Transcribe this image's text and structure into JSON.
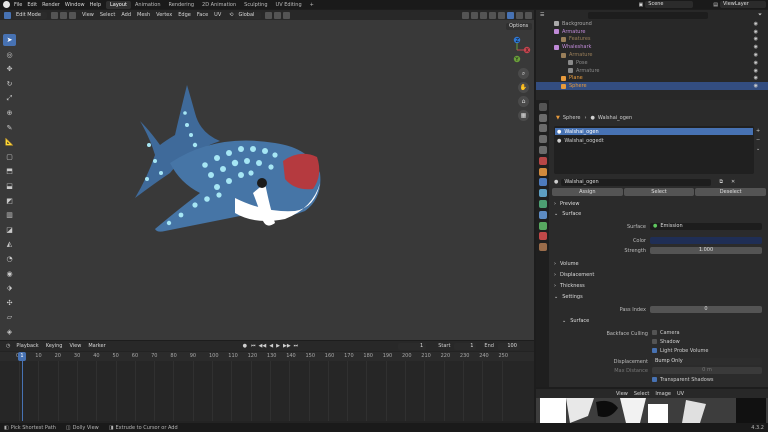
{
  "menu": [
    "File",
    "Edit",
    "Render",
    "Window",
    "Help"
  ],
  "workspaces": [
    "Layout",
    "Animation",
    "Rendering",
    "2D Animation",
    "Sculpting",
    "UV Editing"
  ],
  "active_workspace": "Layout",
  "add_tab": "+",
  "scene": "Scene",
  "view_layer": "ViewLayer",
  "viewport": {
    "mode": "Edit Mode",
    "menus": [
      "View",
      "Select",
      "Add",
      "Mesh",
      "Vertex",
      "Edge",
      "Face",
      "UV"
    ],
    "orientation": "Global",
    "options": "Options"
  },
  "gizmo": {
    "y": "Y",
    "x": "X",
    "z": "Z"
  },
  "timeline": {
    "menus": [
      "Playback",
      "Keying",
      "View",
      "Marker"
    ],
    "current_frame": "1",
    "start_label": "Start",
    "start": "1",
    "end_label": "End",
    "end": "100",
    "ruler": [
      "0",
      "10",
      "20",
      "30",
      "40",
      "50",
      "60",
      "70",
      "80",
      "90",
      "100",
      "110",
      "120",
      "130",
      "140",
      "150",
      "160",
      "170",
      "180",
      "190",
      "200",
      "210",
      "220",
      "230",
      "240",
      "250"
    ]
  },
  "outliner": {
    "search_placeholder": "",
    "rows": [
      {
        "label": "Background",
        "indent": 2,
        "color": "#a9a9a9"
      },
      {
        "label": "Armature",
        "indent": 2,
        "color": "#c08ad8"
      },
      {
        "label": "Features",
        "indent": 3,
        "color": "#9a7f5a"
      },
      {
        "label": "Whaleshark",
        "indent": 2,
        "color": "#c08ad8"
      },
      {
        "label": "Armature",
        "indent": 3,
        "color": "#9a7f5a"
      },
      {
        "label": "Pose",
        "indent": 4,
        "color": "#8a8a8a"
      },
      {
        "label": "Armature",
        "indent": 4,
        "color": "#8a8a8a"
      },
      {
        "label": "Plane",
        "indent": 3,
        "color": "#e79a3c"
      },
      {
        "label": "Sphere",
        "indent": 3,
        "color": "#e79a3c",
        "selected": true
      }
    ]
  },
  "properties": {
    "breadcrumb": [
      "Sphere",
      "Walshai_ogen"
    ],
    "materials": [
      "Walshai_ogen",
      "Walshai_oogedt"
    ],
    "active_material": "Walshai_ogen",
    "slot_buttons": [
      "Assign",
      "Select",
      "Deselect"
    ],
    "sections": {
      "preview": "Preview",
      "surface": "Surface",
      "volume": "Volume",
      "displacement": "Displacement",
      "thickness": "Thickness",
      "settings": "Settings",
      "surface_sub": "Surface"
    },
    "surface_label": "Surface",
    "surface_value": "Emission",
    "color_label": "Color",
    "color_value": "#1f2e55",
    "strength_label": "Strength",
    "strength_value": "1.000",
    "pass_index_label": "Pass Index",
    "pass_index_value": "0",
    "backface_label": "Backface Culling",
    "camera": "Camera",
    "shadow": "Shadow",
    "light_probe": "Light Probe Volume",
    "displacement_label": "Displacement",
    "displacement_value": "Bump Only",
    "max_distance_label": "Max Distance",
    "max_distance_value": "0 m",
    "transparent_shadows": "Transparent Shadows"
  },
  "uv_editor": {
    "menus": [
      "View",
      "Select",
      "Image",
      "UV"
    ]
  },
  "status": [
    "Pick Shortest Path",
    "Dolly View",
    "Extrude to Cursor or Add"
  ],
  "version": "4.3.2"
}
